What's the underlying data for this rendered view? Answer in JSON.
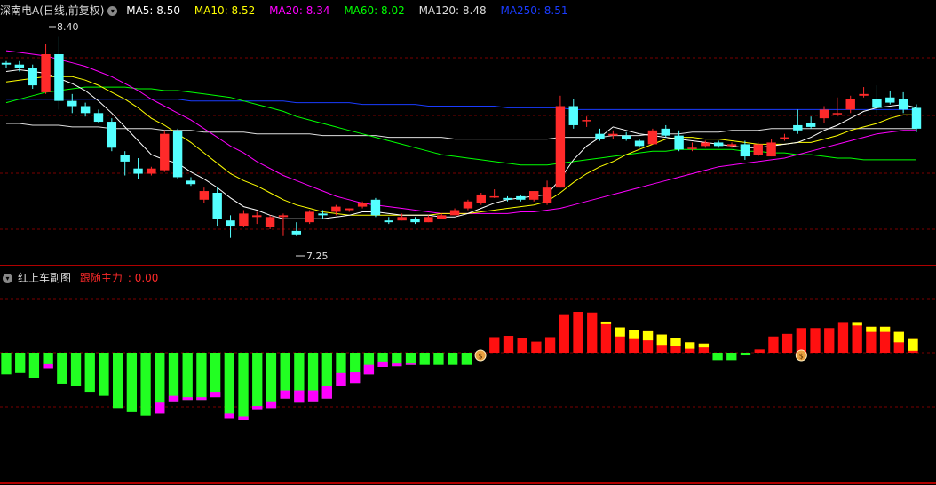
{
  "header": {
    "title": "深南电A(日线,前复权)",
    "ma": [
      {
        "name": "MA5",
        "value": "8.50",
        "color": "#ffffff"
      },
      {
        "name": "MA10",
        "value": "8.52",
        "color": "#ffff00"
      },
      {
        "name": "MA20",
        "value": "8.34",
        "color": "#ff00ff"
      },
      {
        "name": "MA60",
        "value": "8.02",
        "color": "#00ff00"
      },
      {
        "name": "MA120",
        "value": "8.48",
        "color": "#dddddd"
      },
      {
        "name": "MA250",
        "value": "8.51",
        "color": "#1a3cff"
      }
    ]
  },
  "sub_header": {
    "title": "红上车副图",
    "indicator_label": "跟随主力",
    "indicator_value": "0.00"
  },
  "annotations": {
    "high": "8.40",
    "low": "7.25"
  },
  "colors": {
    "up": "#ff2a2a",
    "down": "#54ffff",
    "grid": "#7a0000",
    "ma5": "#ffffff",
    "ma10": "#ffff00",
    "ma20": "#ff00ff",
    "ma60": "#00ff00",
    "ma120": "#dddddd",
    "ma250": "#1a3cff",
    "hist_pos": "#ff1010",
    "hist_neg": "#22ff22",
    "hist_magenta": "#ff00ff",
    "hist_yellow": "#ffff00"
  },
  "chart_data": [
    {
      "type": "candlestick",
      "ylim": [
        7.1,
        8.5
      ],
      "candles": [
        [
          8.25,
          8.26,
          8.22,
          8.24
        ],
        [
          8.24,
          8.26,
          8.2,
          8.22
        ],
        [
          8.22,
          8.24,
          8.1,
          8.12
        ],
        [
          8.08,
          8.36,
          8.07,
          8.3
        ],
        [
          8.3,
          8.4,
          7.98,
          8.03
        ],
        [
          8.03,
          8.07,
          7.96,
          8.0
        ],
        [
          8.0,
          8.02,
          7.94,
          7.96
        ],
        [
          7.96,
          7.98,
          7.9,
          7.91
        ],
        [
          7.91,
          7.93,
          7.74,
          7.76
        ],
        [
          7.72,
          7.74,
          7.6,
          7.68
        ],
        [
          7.64,
          7.7,
          7.58,
          7.61
        ],
        [
          7.61,
          7.65,
          7.6,
          7.64
        ],
        [
          7.63,
          7.86,
          7.62,
          7.84
        ],
        [
          7.86,
          7.87,
          7.58,
          7.59
        ],
        [
          7.57,
          7.59,
          7.54,
          7.55
        ],
        [
          7.46,
          7.53,
          7.44,
          7.51
        ],
        [
          7.5,
          7.53,
          7.31,
          7.35
        ],
        [
          7.34,
          7.37,
          7.24,
          7.31
        ],
        [
          7.31,
          7.4,
          7.3,
          7.38
        ],
        [
          7.36,
          7.39,
          7.32,
          7.37
        ],
        [
          7.3,
          7.37,
          7.29,
          7.36
        ],
        [
          7.36,
          7.38,
          7.25,
          7.37
        ],
        [
          7.28,
          7.33,
          7.25,
          7.26
        ],
        [
          7.33,
          7.4,
          7.32,
          7.39
        ],
        [
          7.38,
          7.4,
          7.35,
          7.37
        ],
        [
          7.39,
          7.43,
          7.37,
          7.42
        ],
        [
          7.4,
          7.41,
          7.39,
          7.41
        ],
        [
          7.42,
          7.45,
          7.41,
          7.44
        ],
        [
          7.46,
          7.47,
          7.36,
          7.37
        ],
        [
          7.34,
          7.36,
          7.32,
          7.33
        ],
        [
          7.34,
          7.38,
          7.34,
          7.36
        ],
        [
          7.35,
          7.36,
          7.32,
          7.33
        ],
        [
          7.33,
          7.37,
          7.33,
          7.36
        ],
        [
          7.35,
          7.38,
          7.35,
          7.37
        ],
        [
          7.37,
          7.41,
          7.37,
          7.4
        ],
        [
          7.41,
          7.46,
          7.4,
          7.45
        ],
        [
          7.44,
          7.5,
          7.43,
          7.49
        ],
        [
          7.48,
          7.52,
          7.47,
          7.48
        ],
        [
          7.47,
          7.48,
          7.45,
          7.46
        ],
        [
          7.48,
          7.49,
          7.45,
          7.46
        ],
        [
          7.46,
          7.51,
          7.45,
          7.51
        ],
        [
          7.44,
          7.57,
          7.43,
          7.53
        ],
        [
          7.53,
          8.06,
          7.53,
          8.0
        ],
        [
          8.0,
          8.04,
          7.87,
          7.89
        ],
        [
          7.92,
          7.94,
          7.88,
          7.92
        ],
        [
          7.84,
          7.87,
          7.8,
          7.81
        ],
        [
          7.83,
          7.86,
          7.81,
          7.84
        ],
        [
          7.83,
          7.85,
          7.8,
          7.81
        ],
        [
          7.8,
          7.81,
          7.76,
          7.77
        ],
        [
          7.78,
          7.87,
          7.78,
          7.86
        ],
        [
          7.87,
          7.89,
          7.82,
          7.83
        ],
        [
          7.83,
          7.86,
          7.74,
          7.75
        ],
        [
          7.76,
          7.79,
          7.74,
          7.76
        ],
        [
          7.77,
          7.8,
          7.76,
          7.79
        ],
        [
          7.79,
          7.8,
          7.76,
          7.77
        ],
        [
          7.77,
          7.79,
          7.76,
          7.78
        ],
        [
          7.78,
          7.8,
          7.69,
          7.71
        ],
        [
          7.72,
          7.79,
          7.71,
          7.78
        ],
        [
          7.71,
          7.81,
          7.71,
          7.79
        ],
        [
          7.81,
          7.84,
          7.8,
          7.82
        ],
        [
          7.89,
          7.98,
          7.84,
          7.86
        ],
        [
          7.9,
          7.94,
          7.87,
          7.88
        ],
        [
          7.93,
          8.0,
          7.9,
          7.98
        ],
        [
          7.96,
          8.05,
          7.94,
          7.96
        ],
        [
          7.98,
          8.06,
          7.96,
          8.04
        ],
        [
          8.06,
          8.11,
          8.05,
          8.07
        ],
        [
          8.04,
          8.12,
          7.96,
          7.99
        ],
        [
          8.05,
          8.09,
          8.01,
          8.02
        ],
        [
          8.04,
          8.08,
          7.96,
          7.98
        ],
        [
          7.99,
          8.01,
          7.85,
          7.87
        ]
      ],
      "ma5": [
        8.2,
        8.21,
        8.2,
        8.19,
        8.16,
        8.13,
        8.09,
        8.03,
        7.96,
        7.88,
        7.8,
        7.72,
        7.69,
        7.67,
        7.62,
        7.58,
        7.53,
        7.47,
        7.42,
        7.4,
        7.37,
        7.35,
        7.35,
        7.35,
        7.35,
        7.36,
        7.37,
        7.39,
        7.39,
        7.38,
        7.37,
        7.37,
        7.37,
        7.36,
        7.36,
        7.38,
        7.41,
        7.44,
        7.46,
        7.47,
        7.48,
        7.49,
        7.58,
        7.69,
        7.77,
        7.82,
        7.88,
        7.86,
        7.84,
        7.83,
        7.82,
        7.81,
        7.8,
        7.79,
        7.78,
        7.77,
        7.76,
        7.76,
        7.77,
        7.78,
        7.79,
        7.82,
        7.86,
        7.89,
        7.93,
        7.97,
        7.99,
        8.0,
        8.01,
        7.99
      ],
      "ma10": [
        8.14,
        8.15,
        8.16,
        8.17,
        8.17,
        8.17,
        8.15,
        8.12,
        8.08,
        8.04,
        7.99,
        7.93,
        7.89,
        7.84,
        7.79,
        7.73,
        7.67,
        7.61,
        7.57,
        7.54,
        7.5,
        7.46,
        7.43,
        7.41,
        7.39,
        7.38,
        7.37,
        7.37,
        7.37,
        7.37,
        7.37,
        7.37,
        7.37,
        7.38,
        7.38,
        7.38,
        7.39,
        7.4,
        7.41,
        7.42,
        7.43,
        7.45,
        7.5,
        7.56,
        7.61,
        7.65,
        7.68,
        7.72,
        7.75,
        7.78,
        7.81,
        7.82,
        7.82,
        7.81,
        7.81,
        7.8,
        7.79,
        7.78,
        7.78,
        7.78,
        7.79,
        7.79,
        7.81,
        7.83,
        7.86,
        7.88,
        7.9,
        7.93,
        7.95,
        7.95
      ],
      "ma20": [
        8.32,
        8.31,
        8.3,
        8.29,
        8.27,
        8.25,
        8.23,
        8.2,
        8.17,
        8.13,
        8.09,
        8.04,
        8.0,
        7.96,
        7.92,
        7.87,
        7.82,
        7.77,
        7.73,
        7.68,
        7.64,
        7.6,
        7.57,
        7.54,
        7.51,
        7.48,
        7.46,
        7.44,
        7.43,
        7.42,
        7.41,
        7.4,
        7.39,
        7.38,
        7.38,
        7.38,
        7.38,
        7.38,
        7.38,
        7.39,
        7.39,
        7.4,
        7.41,
        7.43,
        7.45,
        7.47,
        7.49,
        7.51,
        7.53,
        7.55,
        7.57,
        7.59,
        7.61,
        7.63,
        7.65,
        7.66,
        7.67,
        7.68,
        7.69,
        7.7,
        7.72,
        7.74,
        7.76,
        7.78,
        7.8,
        7.82,
        7.84,
        7.85,
        7.86,
        7.86
      ],
      "ma60": [
        8.02,
        8.04,
        8.06,
        8.08,
        8.09,
        8.1,
        8.11,
        8.11,
        8.11,
        8.11,
        8.1,
        8.1,
        8.09,
        8.09,
        8.08,
        8.07,
        8.06,
        8.05,
        8.03,
        8.01,
        7.99,
        7.97,
        7.94,
        7.92,
        7.9,
        7.88,
        7.86,
        7.84,
        7.82,
        7.8,
        7.78,
        7.76,
        7.74,
        7.72,
        7.71,
        7.7,
        7.69,
        7.68,
        7.67,
        7.66,
        7.66,
        7.66,
        7.67,
        7.68,
        7.69,
        7.7,
        7.71,
        7.72,
        7.73,
        7.74,
        7.74,
        7.75,
        7.75,
        7.75,
        7.75,
        7.75,
        7.74,
        7.74,
        7.73,
        7.73,
        7.72,
        7.72,
        7.71,
        7.7,
        7.7,
        7.69,
        7.69,
        7.69,
        7.69,
        7.69
      ],
      "ma120": [
        7.9,
        7.9,
        7.89,
        7.89,
        7.89,
        7.88,
        7.88,
        7.88,
        7.87,
        7.87,
        7.87,
        7.87,
        7.86,
        7.86,
        7.86,
        7.85,
        7.85,
        7.85,
        7.85,
        7.84,
        7.84,
        7.84,
        7.84,
        7.84,
        7.83,
        7.83,
        7.83,
        7.83,
        7.83,
        7.82,
        7.82,
        7.82,
        7.82,
        7.82,
        7.81,
        7.81,
        7.81,
        7.81,
        7.81,
        7.81,
        7.81,
        7.81,
        7.82,
        7.82,
        7.82,
        7.82,
        7.83,
        7.83,
        7.83,
        7.84,
        7.84,
        7.84,
        7.85,
        7.85,
        7.85,
        7.86,
        7.86,
        7.86,
        7.87,
        7.87,
        7.87,
        7.87,
        7.87,
        7.87,
        7.87,
        7.87,
        7.87,
        7.87,
        7.87,
        7.87
      ],
      "ma250": [
        8.04,
        8.04,
        8.04,
        8.04,
        8.04,
        8.04,
        8.04,
        8.04,
        8.04,
        8.04,
        8.04,
        8.04,
        8.04,
        8.04,
        8.03,
        8.03,
        8.03,
        8.03,
        8.03,
        8.03,
        8.03,
        8.03,
        8.02,
        8.02,
        8.02,
        8.02,
        8.02,
        8.01,
        8.01,
        8.01,
        8.01,
        8.01,
        8.0,
        8.0,
        8.0,
        8.0,
        8.0,
        8.0,
        7.99,
        7.99,
        7.99,
        7.99,
        7.99,
        7.98,
        7.98,
        7.98,
        7.98,
        7.98,
        7.98,
        7.98,
        7.98,
        7.98,
        7.98,
        7.98,
        7.98,
        7.98,
        7.98,
        7.98,
        7.98,
        7.98,
        7.98,
        7.98,
        7.98,
        7.98,
        7.98,
        7.98,
        7.98,
        7.98,
        7.98,
        7.98
      ]
    },
    {
      "type": "bar",
      "ylim": [
        -1,
        1
      ],
      "values": [
        -0.32,
        -0.3,
        -0.38,
        -0.23,
        -0.46,
        -0.5,
        -0.58,
        -0.64,
        -0.82,
        -0.88,
        -0.93,
        -0.9,
        -0.72,
        -0.7,
        -0.7,
        -0.66,
        -0.98,
        -1.0,
        -0.85,
        -0.82,
        -0.68,
        -0.74,
        -0.72,
        -0.68,
        -0.5,
        -0.45,
        -0.32,
        -0.21,
        -0.2,
        -0.18,
        -0.18,
        -0.18,
        -0.18,
        -0.18,
        -0.06,
        0.24,
        0.26,
        0.22,
        0.17,
        0.24,
        0.58,
        0.63,
        0.62,
        0.48,
        0.39,
        0.35,
        0.33,
        0.28,
        0.22,
        0.16,
        0.14,
        -0.11,
        -0.11,
        -0.04,
        0.05,
        0.25,
        0.29,
        0.38,
        0.38,
        0.38,
        0.46,
        0.46,
        0.4,
        0.4,
        0.32,
        0.21
      ],
      "magenta_tops": [
        0,
        0,
        0,
        0.06,
        0,
        0,
        0,
        0,
        0,
        0,
        0,
        0.16,
        0.08,
        0.04,
        0.04,
        0.08,
        0.08,
        0.06,
        0.06,
        0.1,
        0.12,
        0.18,
        0.16,
        0.18,
        0.2,
        0.16,
        0.14,
        0.08,
        0.04,
        0.02,
        0,
        0,
        0,
        0,
        0.04,
        0,
        0,
        0,
        0,
        0,
        0,
        0,
        0,
        0,
        0,
        0,
        0,
        0,
        0,
        0,
        0,
        0,
        0,
        0,
        0,
        0,
        0,
        0,
        0,
        0,
        0,
        0,
        0,
        0,
        0,
        0
      ],
      "yellow_tops": [
        0,
        0,
        0,
        0,
        0,
        0,
        0,
        0,
        0,
        0,
        0,
        0,
        0,
        0,
        0,
        0,
        0,
        0,
        0,
        0,
        0,
        0,
        0,
        0,
        0,
        0,
        0,
        0,
        0,
        0,
        0,
        0,
        0,
        0,
        0,
        0,
        0,
        0,
        0,
        0,
        0,
        0,
        0,
        0.04,
        0.14,
        0.14,
        0.14,
        0.16,
        0.12,
        0.1,
        0.06,
        0,
        0,
        0,
        0,
        0,
        0,
        0,
        0,
        0,
        0,
        0.04,
        0.08,
        0.08,
        0.16,
        0.18
      ],
      "signals": [
        34,
        57
      ]
    }
  ]
}
